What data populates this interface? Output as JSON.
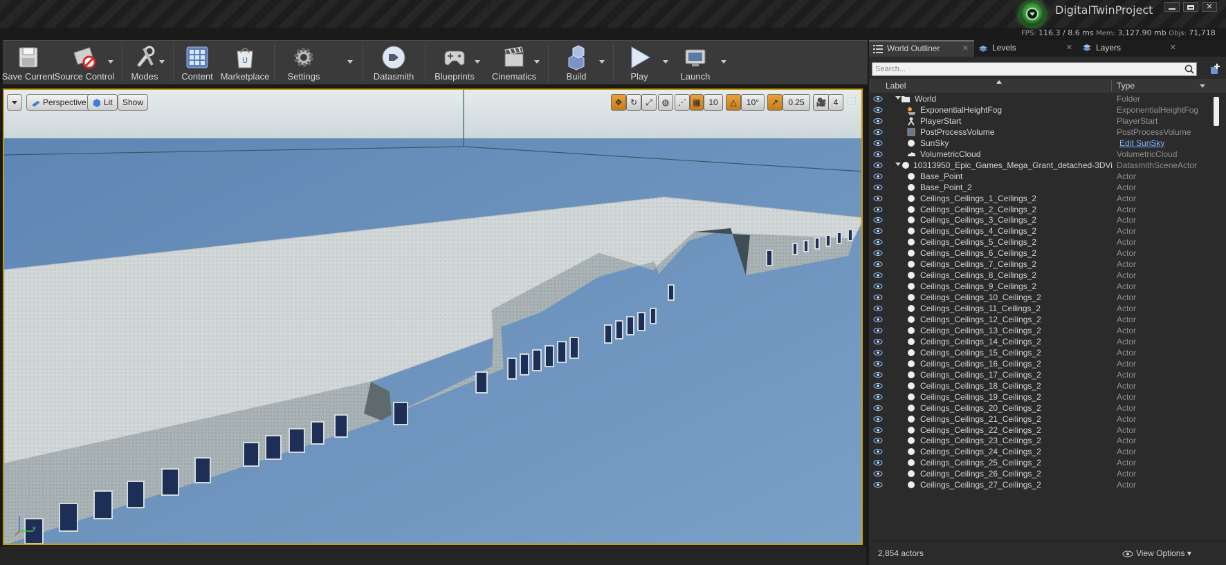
{
  "title_bar": {
    "project_name": "DigitalTwinProject"
  },
  "stats": {
    "fps_label": "FPS:",
    "fps": "116.3",
    "frame_ms": "/ 8.6 ms",
    "mem_label": "Mem:",
    "mem": "3,127.90 mb",
    "objs_label": "Objs:",
    "objs": "71,718"
  },
  "toolbar": {
    "save": "Save Current",
    "source_control": "Source Control",
    "modes": "Modes",
    "content": "Content",
    "marketplace": "Marketplace",
    "settings": "Settings",
    "datasmith": "Datasmith",
    "blueprints": "Blueprints",
    "cinematics": "Cinematics",
    "build": "Build",
    "play": "Play",
    "launch": "Launch"
  },
  "viewport": {
    "perspective": "Perspective",
    "lit": "Lit",
    "show": "Show",
    "grid_snap": "10",
    "rotation_snap": "10°",
    "scale_snap": "0.25",
    "camera_speed": "4"
  },
  "outliner": {
    "tabs": [
      "World Outliner",
      "Levels",
      "Layers"
    ],
    "search_placeholder": "Search...",
    "col_label": "Label",
    "col_type": "Type",
    "rows": [
      {
        "label": "World",
        "type": "Folder"
      },
      {
        "label": "ExponentialHeightFog",
        "type": "ExponentialHeightFog"
      },
      {
        "label": "PlayerStart",
        "type": "PlayerStart"
      },
      {
        "label": "PostProcessVolume",
        "type": "PostProcessVolume"
      },
      {
        "label": "SunSky",
        "type": "Edit SunSky"
      },
      {
        "label": "VolumetricCloud",
        "type": "VolumetricCloud"
      },
      {
        "label": "10313950_Epic_Games_Mega_Grant_detached-3DVi",
        "type": "DatasmithSceneActor"
      },
      {
        "label": "Base_Point",
        "type": "Actor"
      },
      {
        "label": "Base_Point_2",
        "type": "Actor"
      },
      {
        "label": "Ceilings_Ceilings_1_Ceilings_2",
        "type": "Actor"
      },
      {
        "label": "Ceilings_Ceilings_2_Ceilings_2",
        "type": "Actor"
      },
      {
        "label": "Ceilings_Ceilings_3_Ceilings_2",
        "type": "Actor"
      },
      {
        "label": "Ceilings_Ceilings_4_Ceilings_2",
        "type": "Actor"
      },
      {
        "label": "Ceilings_Ceilings_5_Ceilings_2",
        "type": "Actor"
      },
      {
        "label": "Ceilings_Ceilings_6_Ceilings_2",
        "type": "Actor"
      },
      {
        "label": "Ceilings_Ceilings_7_Ceilings_2",
        "type": "Actor"
      },
      {
        "label": "Ceilings_Ceilings_8_Ceilings_2",
        "type": "Actor"
      },
      {
        "label": "Ceilings_Ceilings_9_Ceilings_2",
        "type": "Actor"
      },
      {
        "label": "Ceilings_Ceilings_10_Ceilings_2",
        "type": "Actor"
      },
      {
        "label": "Ceilings_Ceilings_11_Ceilings_2",
        "type": "Actor"
      },
      {
        "label": "Ceilings_Ceilings_12_Ceilings_2",
        "type": "Actor"
      },
      {
        "label": "Ceilings_Ceilings_13_Ceilings_2",
        "type": "Actor"
      },
      {
        "label": "Ceilings_Ceilings_14_Ceilings_2",
        "type": "Actor"
      },
      {
        "label": "Ceilings_Ceilings_15_Ceilings_2",
        "type": "Actor"
      },
      {
        "label": "Ceilings_Ceilings_16_Ceilings_2",
        "type": "Actor"
      },
      {
        "label": "Ceilings_Ceilings_17_Ceilings_2",
        "type": "Actor"
      },
      {
        "label": "Ceilings_Ceilings_18_Ceilings_2",
        "type": "Actor"
      },
      {
        "label": "Ceilings_Ceilings_19_Ceilings_2",
        "type": "Actor"
      },
      {
        "label": "Ceilings_Ceilings_20_Ceilings_2",
        "type": "Actor"
      },
      {
        "label": "Ceilings_Ceilings_21_Ceilings_2",
        "type": "Actor"
      },
      {
        "label": "Ceilings_Ceilings_22_Ceilings_2",
        "type": "Actor"
      },
      {
        "label": "Ceilings_Ceilings_23_Ceilings_2",
        "type": "Actor"
      },
      {
        "label": "Ceilings_Ceilings_24_Ceilings_2",
        "type": "Actor"
      },
      {
        "label": "Ceilings_Ceilings_25_Ceilings_2",
        "type": "Actor"
      },
      {
        "label": "Ceilings_Ceilings_26_Ceilings_2",
        "type": "Actor"
      },
      {
        "label": "Ceilings_Ceilings_27_Ceilings_2",
        "type": "Actor"
      }
    ],
    "actor_count": "2,854 actors",
    "view_options": "View Options"
  },
  "colors": {
    "accent": "#c7a000",
    "link": "#7fb3ff",
    "sky": "#6f93bb"
  }
}
